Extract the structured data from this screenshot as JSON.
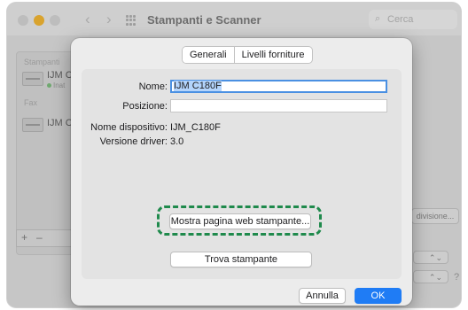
{
  "window": {
    "title": "Stampanti e Scanner",
    "search_placeholder": "Cerca",
    "search_icon": "magnifier-icon",
    "accent": "#1f7cf5"
  },
  "sidebar": {
    "printers_header": "Stampanti",
    "items": [
      {
        "name": "IJM C",
        "status": "Inat"
      },
      {
        "name": "IJM C",
        "status": ""
      }
    ],
    "fax_header": "Fax",
    "add_label": "+",
    "remove_label": "–"
  },
  "background": {
    "share_button": "divisione...",
    "help_label": "?"
  },
  "sheet": {
    "tabs": [
      "Generali",
      "Livelli forniture"
    ],
    "name_label": "Nome:",
    "name_value": "IJM C180F",
    "location_label": "Posizione:",
    "location_value": "",
    "device_name_label": "Nome dispositivo:",
    "device_name_value": "IJM_C180F",
    "driver_version_label": "Versione driver:",
    "driver_version_value": "3.0",
    "web_page_button": "Mostra pagina web stampante...",
    "find_printer_button": "Trova stampante",
    "cancel_button": "Annulla",
    "ok_button": "OK",
    "highlight_color": "#1f8a4c"
  }
}
